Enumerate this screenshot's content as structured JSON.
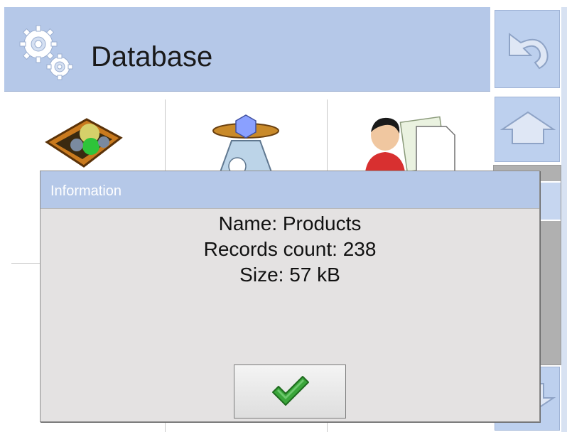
{
  "header": {
    "title": "Database",
    "icon": "gears-icon"
  },
  "sidebar": {
    "back_icon": "undo-arrow-icon",
    "up_icon": "arrow-up-icon",
    "down_icon": "arrow-down-icon"
  },
  "tiles": [
    {
      "icon": "products-box-icon"
    },
    {
      "icon": "scale-icon"
    },
    {
      "icon": "operator-document-icon"
    }
  ],
  "dialog": {
    "title": "Information",
    "lines": [
      "Name: Products",
      "Records count: 238",
      "Size: 57 kB"
    ],
    "ok_icon": "checkmark-icon"
  },
  "colors": {
    "header_bg": "#b5c8e8",
    "dialog_bg": "#e4e2e2",
    "checkmark": "#3aa63a"
  }
}
